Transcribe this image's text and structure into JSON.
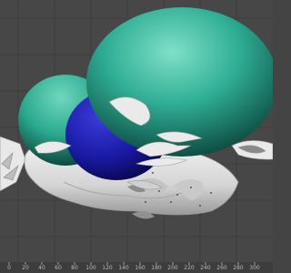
{
  "viewport": {
    "background": "#474747",
    "grid_color": "#3e3e3e",
    "objects": [
      {
        "name": "teal-sphere-large",
        "color": "#2fae95"
      },
      {
        "name": "teal-sphere-small",
        "color": "#2aa98e"
      },
      {
        "name": "blue-sphere",
        "color": "#1a1aa6"
      },
      {
        "name": "white-rock-mesh",
        "color": "#d9d9d9"
      }
    ]
  },
  "timeline_ruler": {
    "ticks": [
      "0",
      "20",
      "40",
      "60",
      "80",
      "100",
      "120",
      "140",
      "160",
      "180",
      "200",
      "220",
      "240",
      "260",
      "280",
      "300"
    ]
  }
}
